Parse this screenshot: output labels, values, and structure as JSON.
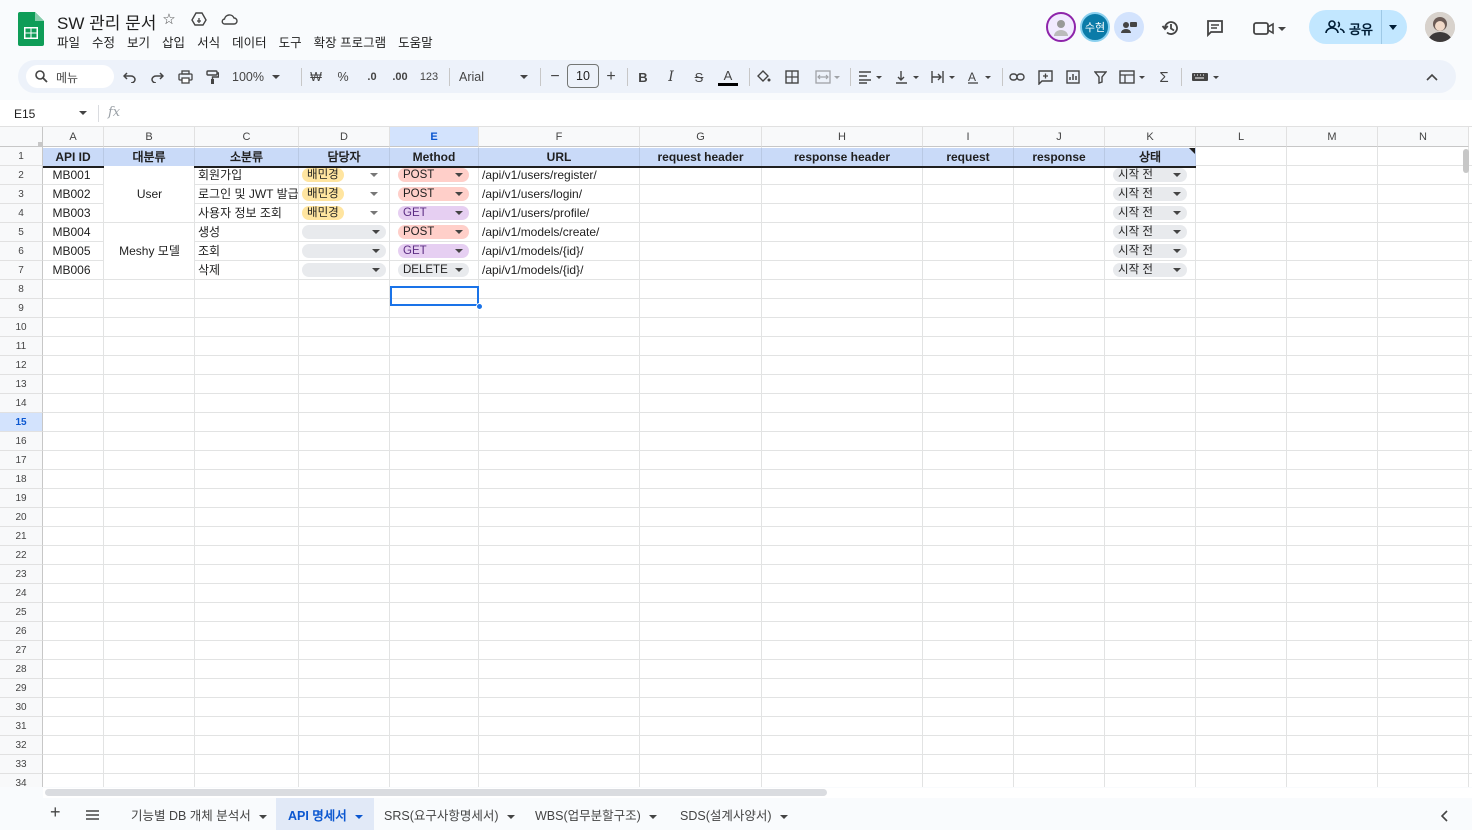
{
  "app": {
    "title": "SW 관리 문서"
  },
  "menu": [
    "파일",
    "수정",
    "보기",
    "삽입",
    "서식",
    "데이터",
    "도구",
    "확장 프로그램",
    "도움말"
  ],
  "header_right": {
    "collaborator_initials": "수현",
    "share_label": "공유"
  },
  "toolbar": {
    "search_label": "메뉴",
    "zoom": "100%",
    "currency": "₩",
    "percent": "%",
    "dec_decrease": ".0",
    "dec_increase": ".00",
    "number_format": "123",
    "font": "Arial",
    "font_size": "10"
  },
  "formula_bar": {
    "name_box": "E15",
    "fx": "fx"
  },
  "columns": [
    "A",
    "B",
    "C",
    "D",
    "E",
    "F",
    "G",
    "H",
    "I",
    "J",
    "K",
    "L",
    "M",
    "N"
  ],
  "selected_column": "E",
  "selected_row": "15",
  "rows": [
    "1",
    "2",
    "3",
    "4",
    "5",
    "6",
    "7",
    "8",
    "9",
    "10",
    "11",
    "12",
    "13",
    "14",
    "15",
    "16",
    "17",
    "18",
    "19",
    "20",
    "21",
    "22",
    "23",
    "24",
    "25",
    "26",
    "27",
    "28",
    "29",
    "30",
    "31",
    "32",
    "33",
    "34"
  ],
  "table": {
    "headers": [
      "API ID",
      "대분류",
      "소분류",
      "담당자",
      "Method",
      "URL",
      "request header",
      "response header",
      "request",
      "response",
      "상태"
    ],
    "groups": [
      {
        "label": "User"
      },
      {
        "label": "Meshy 모델"
      }
    ],
    "records": [
      {
        "id": "MB001",
        "sub": "회원가입",
        "owner": "배민경",
        "method": "POST",
        "url": "/api/v1/users/register/",
        "status": "시작 전"
      },
      {
        "id": "MB002",
        "sub": "로그인 및 JWT 발급",
        "owner": "배민경",
        "method": "POST",
        "url": "/api/v1/users/login/",
        "status": "시작 전"
      },
      {
        "id": "MB003",
        "sub": "사용자 정보 조회",
        "owner": "배민경",
        "method": "GET",
        "url": "/api/v1/users/profile/",
        "status": "시작 전"
      },
      {
        "id": "MB004",
        "sub": "생성",
        "owner": "",
        "method": "POST",
        "url": "/api/v1/models/create/",
        "status": "시작 전"
      },
      {
        "id": "MB005",
        "sub": "조회",
        "owner": "",
        "method": "GET",
        "url": "/api/v1/models/{id}/",
        "status": "시작 전"
      },
      {
        "id": "MB006",
        "sub": "삭제",
        "owner": "",
        "method": "DELETE",
        "url": "/api/v1/models/{id}/",
        "status": "시작 전"
      }
    ]
  },
  "method_colors": {
    "POST": "#ffcfc9",
    "GET": "#e6cff2",
    "DELETE": "#e8eaed"
  },
  "owner_color": "#ffe5a0",
  "sheets": [
    {
      "label": "기능별 DB 개체 분석서",
      "active": false
    },
    {
      "label": "API 명세서",
      "active": true
    },
    {
      "label": "SRS(요구사항명세서)",
      "active": false
    },
    {
      "label": "WBS(업무분할구조)",
      "active": false
    },
    {
      "label": "SDS(설계사양서)",
      "active": false
    }
  ]
}
